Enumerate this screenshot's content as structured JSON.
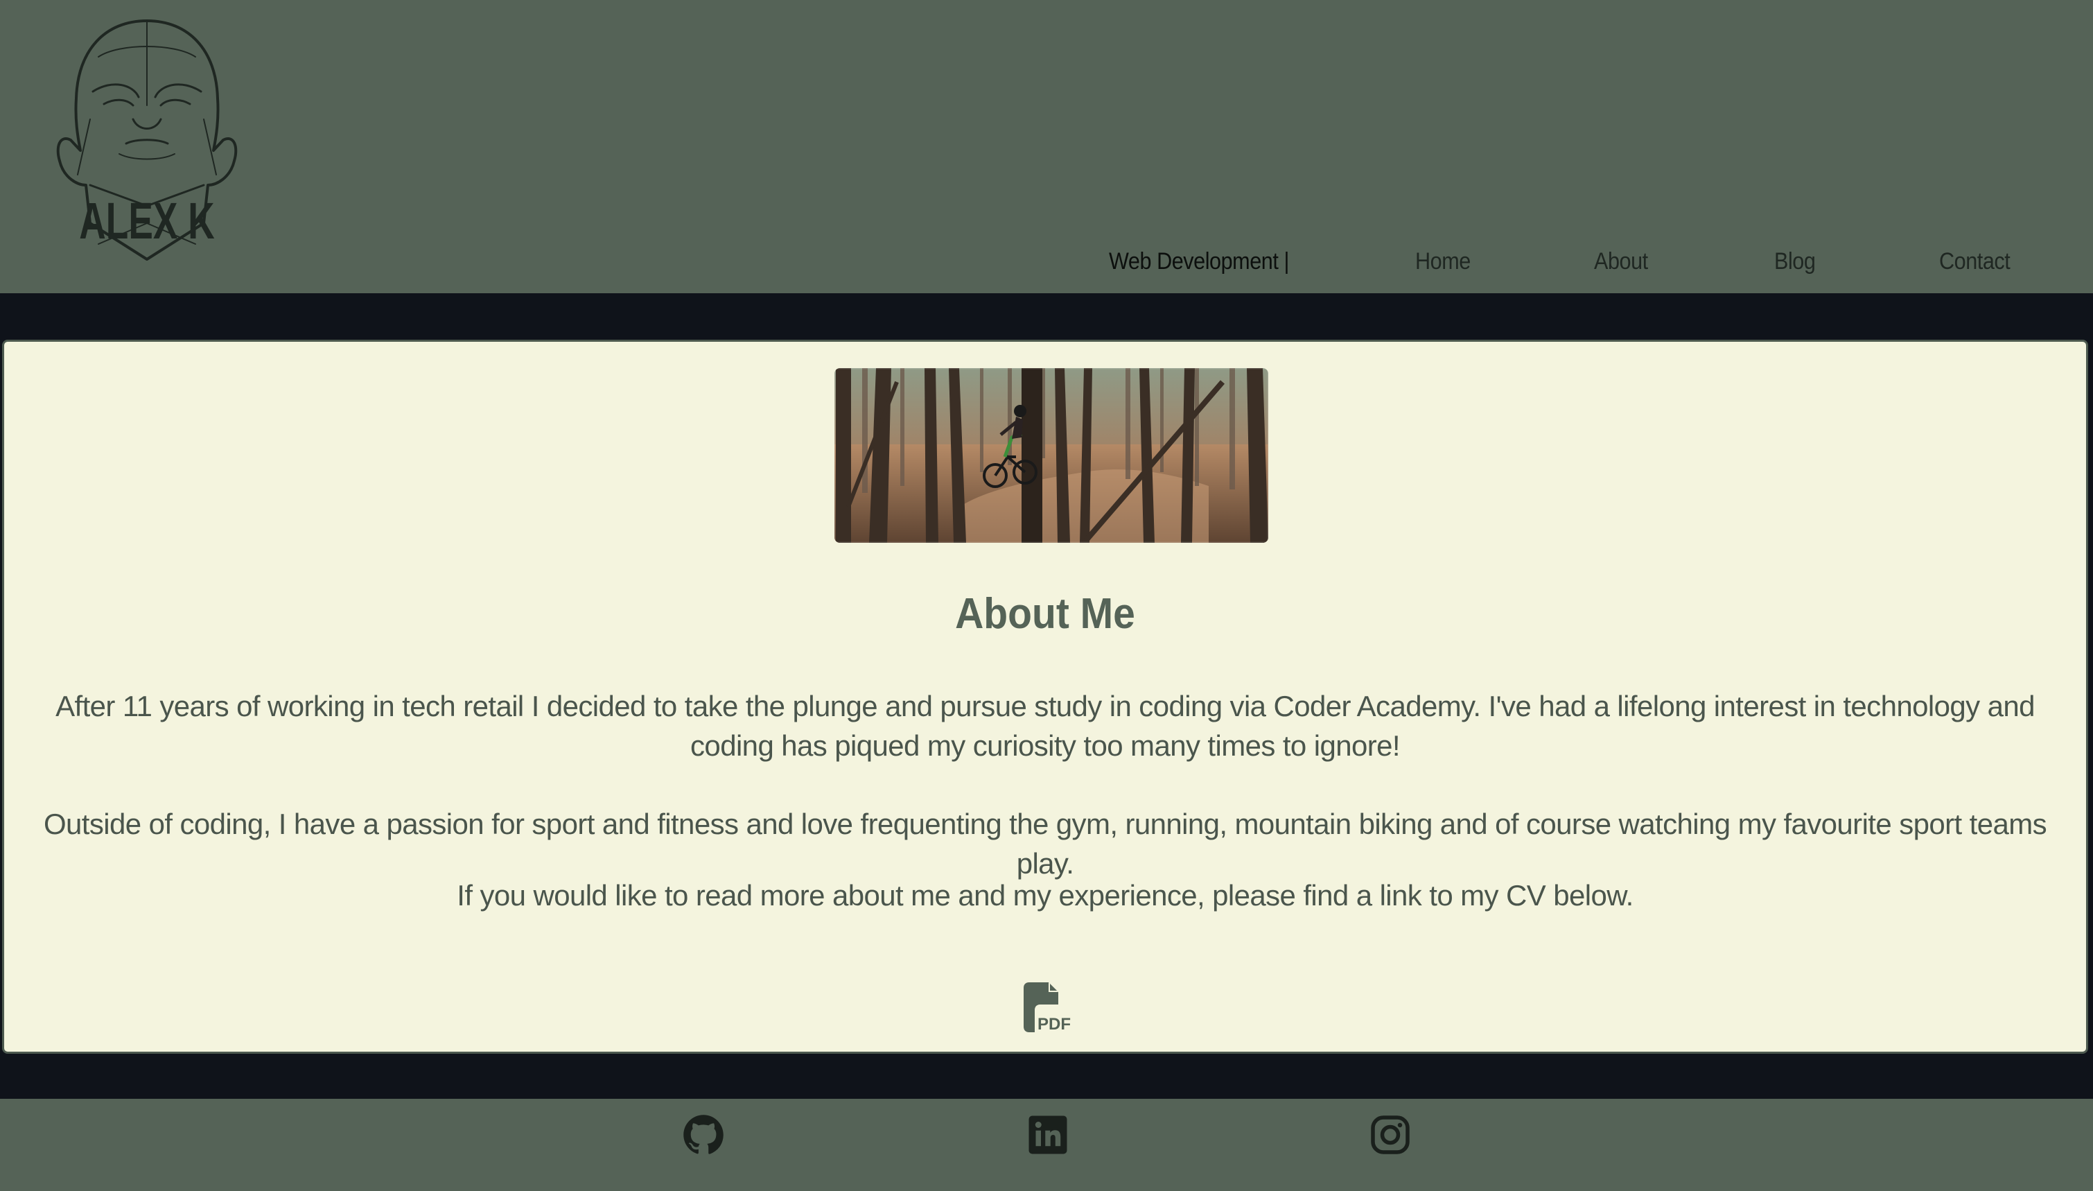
{
  "colors": {
    "header_bg": "#556357",
    "band_bg": "#0f131a",
    "card_bg": "#f4f4de",
    "heading": "#556357",
    "body_text": "#4a554c",
    "icon": "#1a201c"
  },
  "logo": {
    "text": "ALEX K"
  },
  "nav": {
    "brand": "Web Development |",
    "items": [
      {
        "label": "Home"
      },
      {
        "label": "About"
      },
      {
        "label": "Blog"
      },
      {
        "label": "Contact"
      }
    ]
  },
  "about": {
    "title": "About Me",
    "paragraphs": [
      "After 11 years of working in tech retail I decided to take the plunge and pursue study in coding via Coder Academy. I've had a lifelong interest in technology and coding has piqued my curiosity too many times to ignore!",
      "Outside of coding, I have a passion for sport and fitness and love frequenting the gym, running, mountain biking and of course watching my favourite sport teams play.",
      "If you would like to read more about me and my experience, please find a link to my CV below."
    ],
    "cv_icon": "pdf-file-icon",
    "cv_icon_text": "PDF"
  },
  "footer": {
    "socials": [
      {
        "icon": "github-icon"
      },
      {
        "icon": "linkedin-icon"
      },
      {
        "icon": "instagram-icon"
      }
    ]
  }
}
